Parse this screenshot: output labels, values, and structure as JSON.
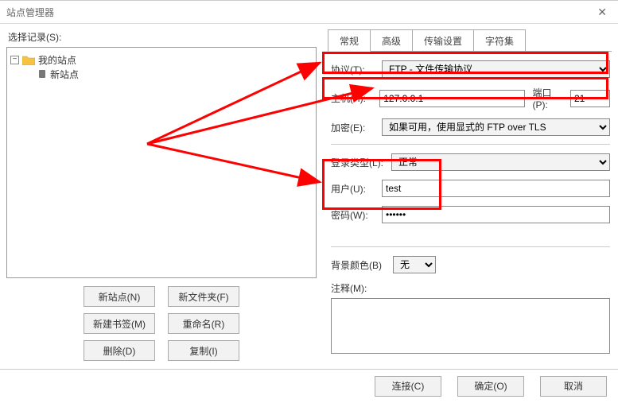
{
  "window": {
    "title": "站点管理器"
  },
  "left": {
    "select_label": "选择记录(S):",
    "root": "我的站点",
    "child": "新站点",
    "buttons": {
      "new_site": "新站点(N)",
      "new_folder": "新文件夹(F)",
      "new_bookmark": "新建书签(M)",
      "rename": "重命名(R)",
      "delete": "删除(D)",
      "copy": "复制(I)"
    }
  },
  "tabs": {
    "general": "常规",
    "advanced": "高级",
    "transfer": "传输设置",
    "charset": "字符集"
  },
  "form": {
    "protocol_label": "协议(T):",
    "protocol_value": "FTP - 文件传输协议",
    "host_label": "主机(H):",
    "host_value": "127.0.0.1",
    "port_label": "端口(P):",
    "port_value": "21",
    "encryption_label": "加密(E):",
    "encryption_value": "如果可用，使用显式的 FTP over TLS",
    "logon_label": "登录类型(L):",
    "logon_value": "正常",
    "user_label": "用户(U):",
    "user_value": "test",
    "pass_label": "密码(W):",
    "pass_value": "••••••",
    "bgcolor_label": "背景颜色(B)",
    "bgcolor_value": "无",
    "notes_label": "注释(M):"
  },
  "footer": {
    "connect": "连接(C)",
    "ok": "确定(O)",
    "cancel": "取消"
  }
}
